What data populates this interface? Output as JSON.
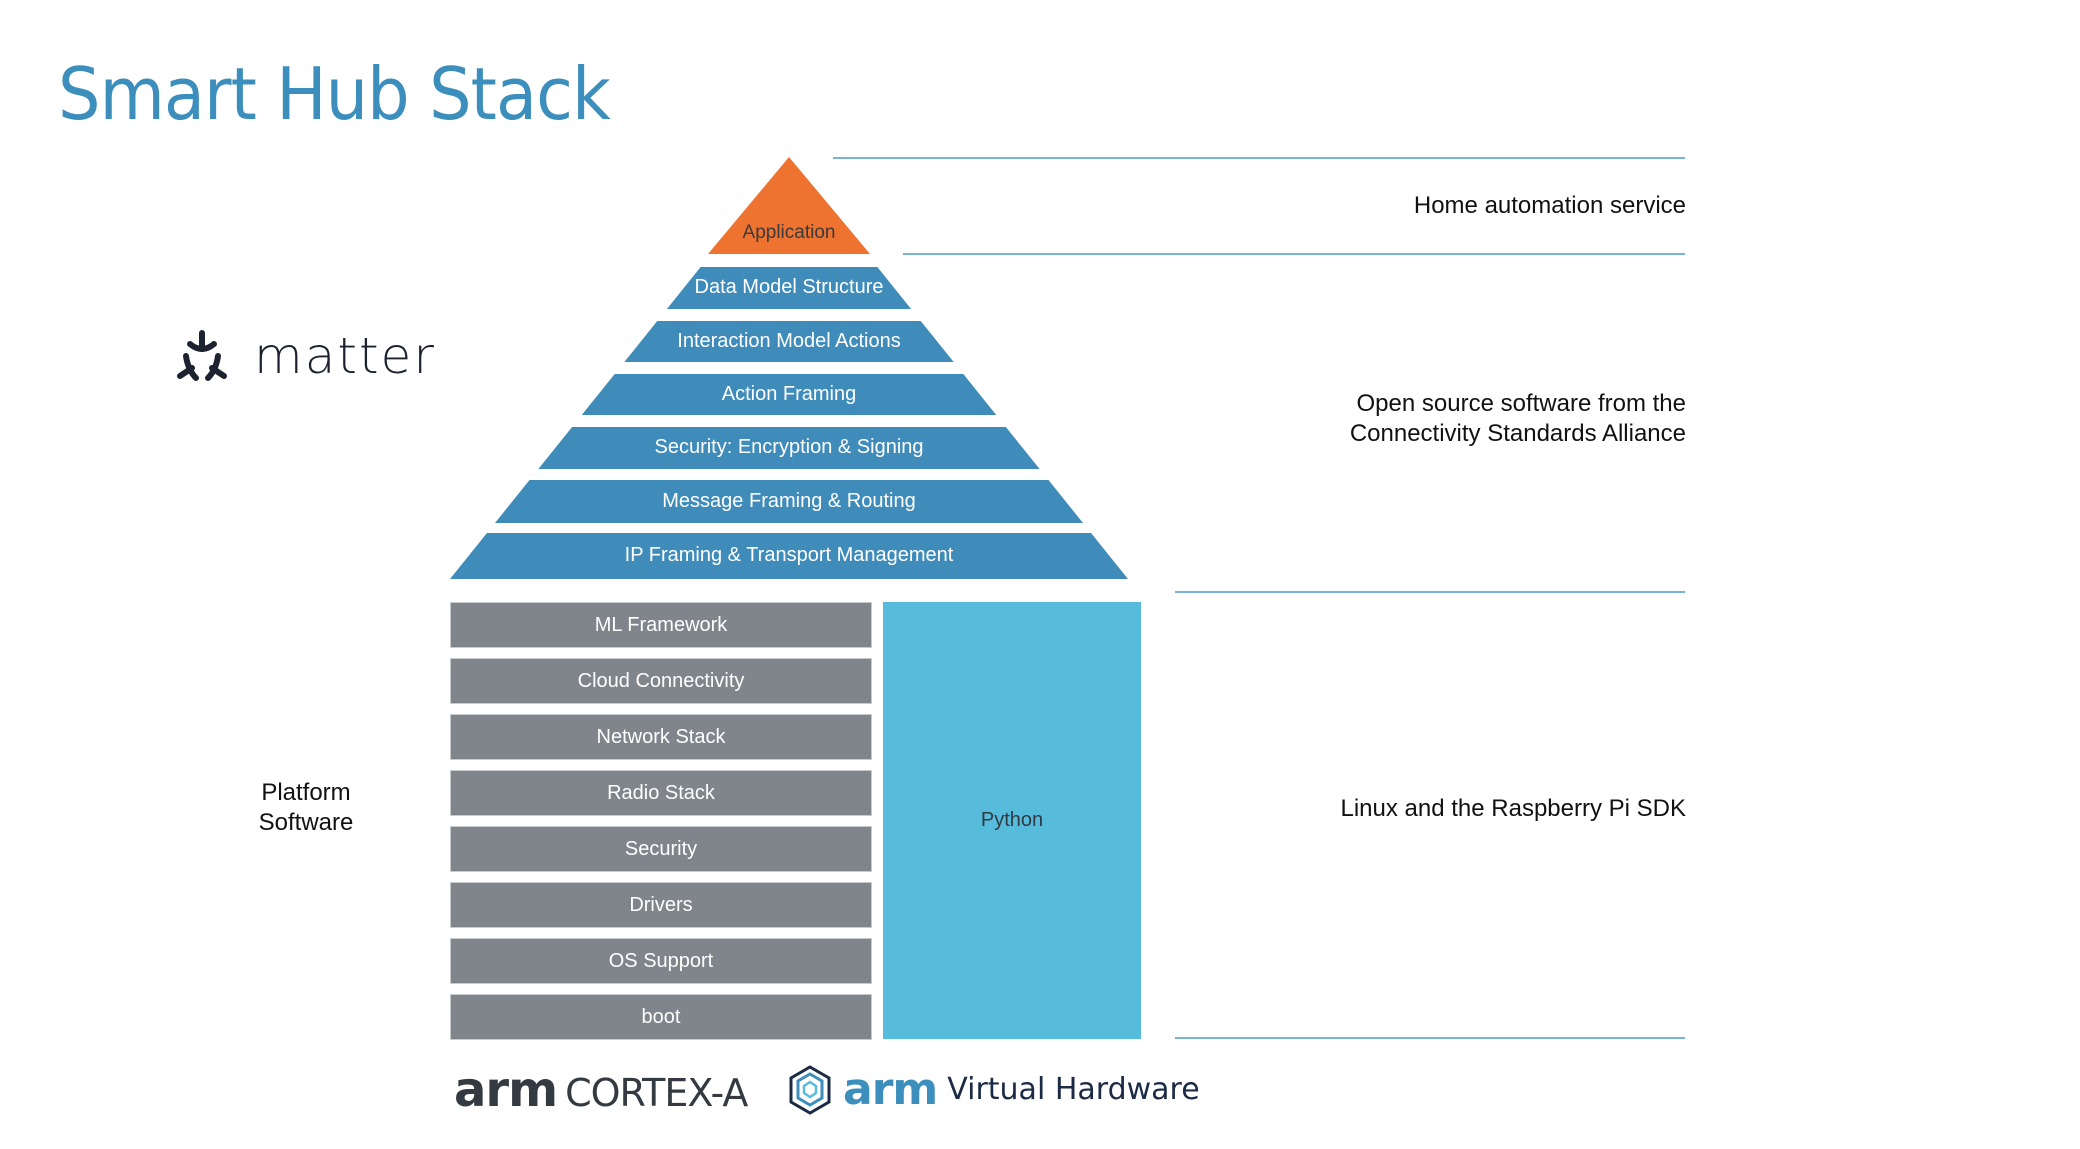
{
  "slide": {
    "title": "Smart Hub Stack",
    "colors": {
      "title": "#3c8ebc",
      "application": "#ee7330",
      "protocol_band": "#3f8cbb",
      "platform_box": "#7f858b",
      "python_box": "#57bcdc",
      "divider": "#7ab3d9"
    }
  },
  "pyramid": {
    "apex_label": "Application",
    "bands": [
      "Data Model Structure",
      "Interaction Model Actions",
      "Action Framing",
      "Security: Encryption & Signing",
      "Message Framing & Routing",
      "IP Framing & Transport Management"
    ]
  },
  "platform": {
    "label_line1": "Platform",
    "label_line2": "Software",
    "boxes": [
      "ML Framework",
      "Cloud Connectivity",
      "Network Stack",
      "Radio Stack",
      "Security",
      "Drivers",
      "OS Support",
      "boot"
    ],
    "python_label": "Python"
  },
  "annotations": {
    "application": "Home automation service",
    "matter_line1": "Open source software from the",
    "matter_line2": "Connectivity Standards Alliance",
    "platform": "Linux and the Raspberry Pi SDK"
  },
  "logos": {
    "matter": "matter",
    "arm": "arm",
    "cortex": "CORTEX-A",
    "vh_arm": "arm",
    "virtual_hardware": "Virtual Hardware"
  }
}
